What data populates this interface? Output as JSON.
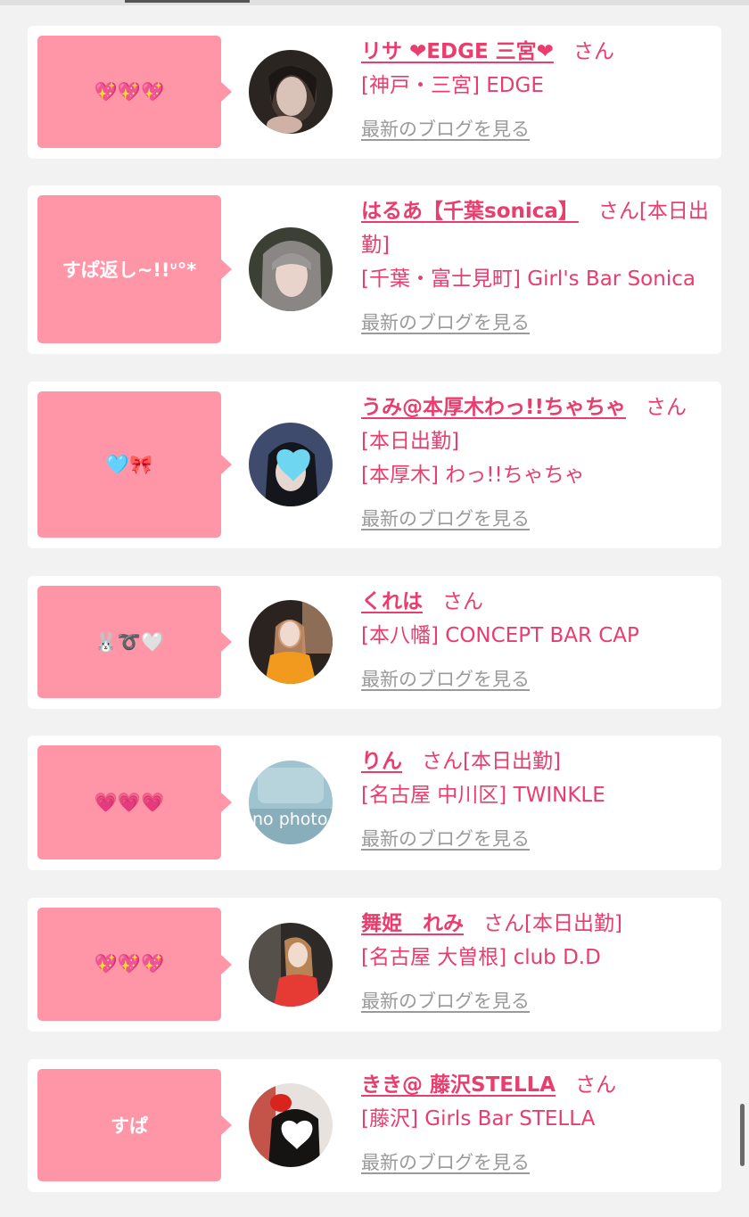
{
  "entries": [
    {
      "bubble": "💖💖💖",
      "name": "リサ ❤︎EDGE 三宮❤︎",
      "san": "さん",
      "status": "",
      "shop": "[神戸・三宮] EDGE",
      "blog": "最新のブログを見る"
    },
    {
      "bubble": "すぱ返し~!!ᐡ°*",
      "name": "はるあ【千葉sonica】",
      "san": "さん",
      "status": "[本日出勤]",
      "shop": "[千葉・富士見町] Girl's Bar Sonica",
      "blog": "最新のブログを見る"
    },
    {
      "bubble": "🩵🎀",
      "name": "うみ@本厚木わっ!!ちゃちゃ",
      "san": "さん",
      "status": "[本日出勤]",
      "shop": "[本厚木] わっ!!ちゃちゃ",
      "blog": "最新のブログを見る"
    },
    {
      "bubble": "🐰➰🤍",
      "name": "くれは",
      "san": "さん",
      "status": "",
      "shop": "[本八幡] CONCEPT BAR CAP",
      "blog": "最新のブログを見る"
    },
    {
      "bubble": "💗💗💗",
      "name": "りん",
      "san": "さん",
      "status": "[本日出勤]",
      "shop": "[名古屋 中川区] TWINKLE",
      "blog": "最新のブログを見る",
      "avatar_text": "no photo"
    },
    {
      "bubble": "💖💖💖",
      "name": "舞姫　れみ",
      "san": "さん",
      "status": "[本日出勤]",
      "shop": "[名古屋 大曽根] club D.D",
      "blog": "最新のブログを見る"
    },
    {
      "bubble": "すぱ",
      "name": "きき@ 藤沢STELLA",
      "san": "さん",
      "status": "",
      "shop": "[藤沢] Girls Bar STELLA",
      "blog": "最新のブログを見る"
    }
  ],
  "colors": {
    "page_bg": "#f2f2f2",
    "bubble_bg": "#ff96a8",
    "accent_text": "#e83d6d",
    "link_gray": "#9a9a9a"
  }
}
